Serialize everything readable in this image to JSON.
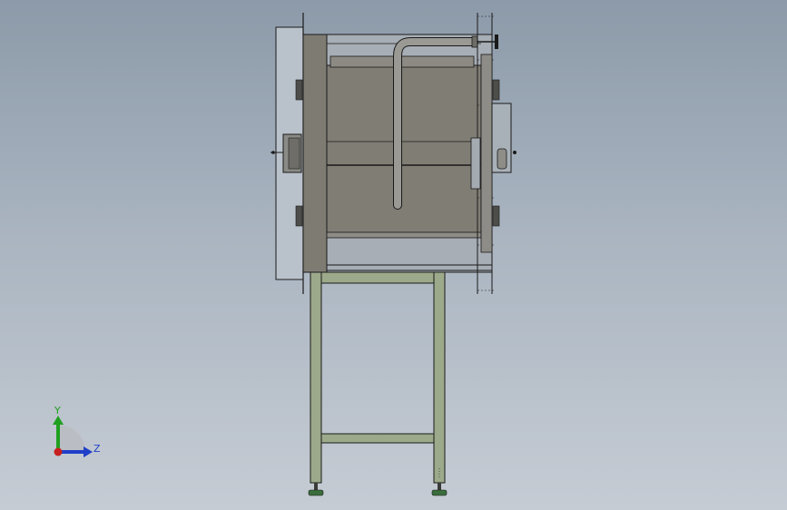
{
  "triad": {
    "y_label": "Y",
    "z_label": "Z",
    "y_color": "#1fa01f",
    "z_color": "#1f3fc8",
    "x_color": "#c81f1f"
  },
  "colors": {
    "background_top": "#8c9aa9",
    "background_bottom": "#c6ccd4",
    "tank_body": "#7d7a72",
    "frame_green": "#9ca98a",
    "line": "#1a1a1a"
  }
}
